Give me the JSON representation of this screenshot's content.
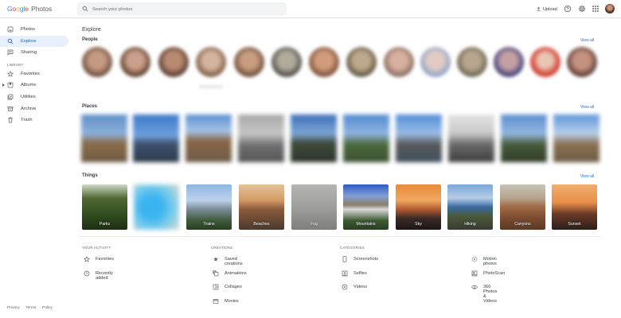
{
  "app": {
    "logo_parts": [
      "G",
      "o",
      "o",
      "g",
      "l",
      "e"
    ],
    "logo_product": "Photos"
  },
  "search": {
    "placeholder": "Search your photos"
  },
  "header": {
    "upload_label": "Upload"
  },
  "sidebar": {
    "items_top": [
      {
        "label": "Photos",
        "icon": "photo-icon"
      },
      {
        "label": "Explore",
        "icon": "search-icon",
        "active": true
      },
      {
        "label": "Sharing",
        "icon": "chat-icon"
      }
    ],
    "library_label": "LIBRARY",
    "items_library": [
      {
        "label": "Favorites",
        "icon": "star-icon"
      },
      {
        "label": "Albums",
        "icon": "album-icon"
      },
      {
        "label": "Utilities",
        "icon": "utilities-icon"
      },
      {
        "label": "Archive",
        "icon": "archive-icon"
      },
      {
        "label": "Trash",
        "icon": "trash-icon"
      }
    ],
    "footer": [
      "Privacy",
      "Terms",
      "Policy"
    ]
  },
  "main": {
    "title": "Explore",
    "people": {
      "heading": "People",
      "view_all": "View all"
    },
    "places": {
      "heading": "Places",
      "view_all": "View all"
    },
    "things": {
      "heading": "Things",
      "view_all": "View all",
      "items": [
        "Parks",
        "",
        "Trains",
        "Beaches",
        "Fog",
        "Mountains",
        "Sky",
        "Hiking",
        "Canyons",
        "Sunset"
      ]
    },
    "your_activity": {
      "label": "YOUR ACTIVITY",
      "items": [
        {
          "label": "Favorites",
          "icon": "star-icon"
        },
        {
          "label": "Recently added",
          "icon": "clock-icon"
        }
      ]
    },
    "creations": {
      "label": "CREATIONS",
      "items": [
        {
          "label": "Saved creations",
          "icon": "saved-icon"
        },
        {
          "label": "Animations",
          "icon": "animation-icon"
        },
        {
          "label": "Collages",
          "icon": "collage-icon"
        },
        {
          "label": "Movies",
          "icon": "movie-icon"
        }
      ]
    },
    "categories": {
      "label": "CATEGORIES",
      "items": [
        {
          "label": "Screenshots",
          "icon": "phone-icon"
        },
        {
          "label": "Selfies",
          "icon": "selfie-icon"
        },
        {
          "label": "Videos",
          "icon": "play-icon"
        },
        {
          "label": "Motion photos",
          "icon": "motion-icon"
        },
        {
          "label": "PhotoScan",
          "icon": "photoscan-icon"
        },
        {
          "label": "360 Photos & Videos",
          "icon": "panorama-icon"
        }
      ]
    }
  },
  "colors": {
    "accent": "#1a73e8",
    "active_bg": "#e8f0fe"
  }
}
